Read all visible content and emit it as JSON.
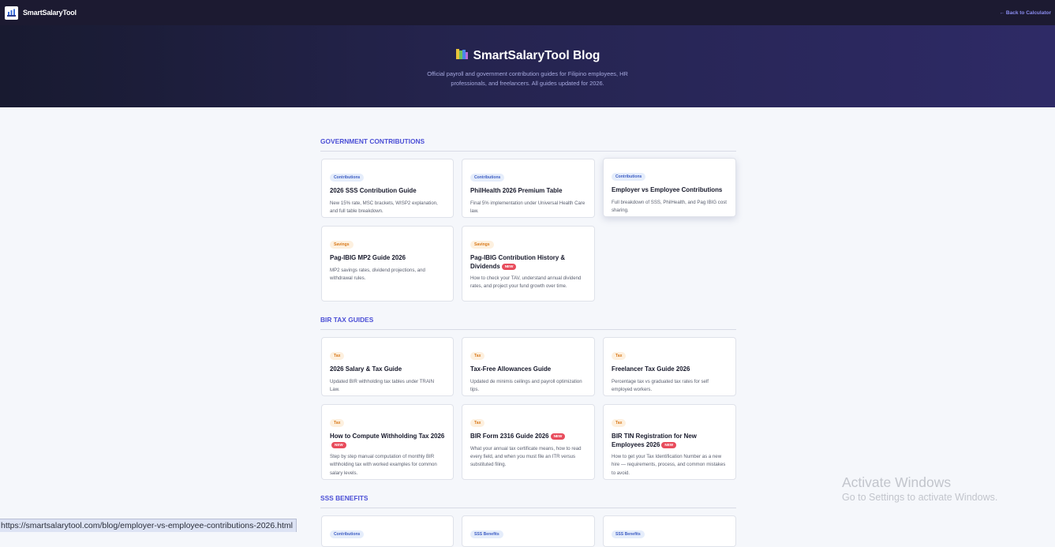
{
  "header": {
    "brand_name": "SmartSalaryTool",
    "back_link": "← Back to Calculator"
  },
  "hero": {
    "title": "SmartSalaryTool Blog",
    "subtitle": "Official payroll and government contribution guides for Filipino employees, HR professionals, and freelancers. All guides updated for 2026."
  },
  "sections": [
    {
      "title": "GOVERNMENT CONTRIBUTIONS",
      "cards": [
        {
          "tag": "Contributions",
          "title": "2026 SSS Contribution Guide",
          "new": false,
          "desc": "New 15% rate, MSC brackets, WISP2 explanation, and full table breakdown."
        },
        {
          "tag": "Contributions",
          "title": "PhilHealth 2026 Premium Table",
          "new": false,
          "desc": "Final 5% implementation under Universal Health Care law."
        },
        {
          "tag": "Contributions",
          "title": "Employer vs Employee Contributions",
          "new": false,
          "desc": "Full breakdown of SSS, PhilHealth, and Pag IBIG cost sharing."
        },
        {
          "tag": "Savings",
          "title": "Pag-IBIG MP2 Guide 2026",
          "new": false,
          "desc": "MP2 savings rates, dividend projections, and withdrawal rules."
        },
        {
          "tag": "Savings",
          "title": "Pag-IBIG Contribution History & Dividends",
          "new": true,
          "desc": "How to check your TAV, understand annual dividend rates, and project your fund growth over time."
        }
      ]
    },
    {
      "title": "BIR TAX GUIDES",
      "cards": [
        {
          "tag": "Tax",
          "title": "2026 Salary & Tax Guide",
          "new": false,
          "desc": "Updated BIR withholding tax tables under TRAIN Law."
        },
        {
          "tag": "Tax",
          "title": "Tax-Free Allowances Guide",
          "new": false,
          "desc": "Updated de minimis ceilings and payroll optimization tips."
        },
        {
          "tag": "Tax",
          "title": "Freelancer Tax Guide 2026",
          "new": false,
          "desc": "Percentage tax vs graduated tax rates for self employed workers."
        },
        {
          "tag": "Tax",
          "title": "How to Compute Withholding Tax 2026",
          "new": true,
          "desc": "Step by step manual computation of monthly BIR withholding tax with worked examples for common salary levels."
        },
        {
          "tag": "Tax",
          "title": "BIR Form 2316 Guide 2026",
          "new": true,
          "desc": "What your annual tax certificate means, how to read every field, and when you must file an ITR versus substituted filing."
        },
        {
          "tag": "Tax",
          "title": "BIR TIN Registration for New Employees 2026",
          "new": true,
          "desc": "How to get your Tax Identification Number as a new hire — requirements, process, and common mistakes to avoid."
        }
      ]
    },
    {
      "title": "SSS BENEFITS",
      "cards": [
        {
          "tag": "Contributions",
          "title": "",
          "new": false,
          "desc": ""
        },
        {
          "tag": "SSS Benefits",
          "title": "",
          "new": false,
          "desc": ""
        },
        {
          "tag": "SSS Benefits",
          "title": "",
          "new": false,
          "desc": ""
        }
      ]
    }
  ],
  "new_badge_label": "NEW",
  "watermark": {
    "line1": "Activate Windows",
    "line2": "Go to Settings to activate Windows."
  },
  "status_url": "https://smartsalarytool.com/blog/employer-vs-employee-contributions-2026.html",
  "colors": {
    "accent": "#4b4fd6",
    "header_bg": "#1c1a31",
    "tag_blue": "#3e5ec4",
    "tag_orange": "#d97a1c",
    "new_badge": "#e84c5c"
  }
}
